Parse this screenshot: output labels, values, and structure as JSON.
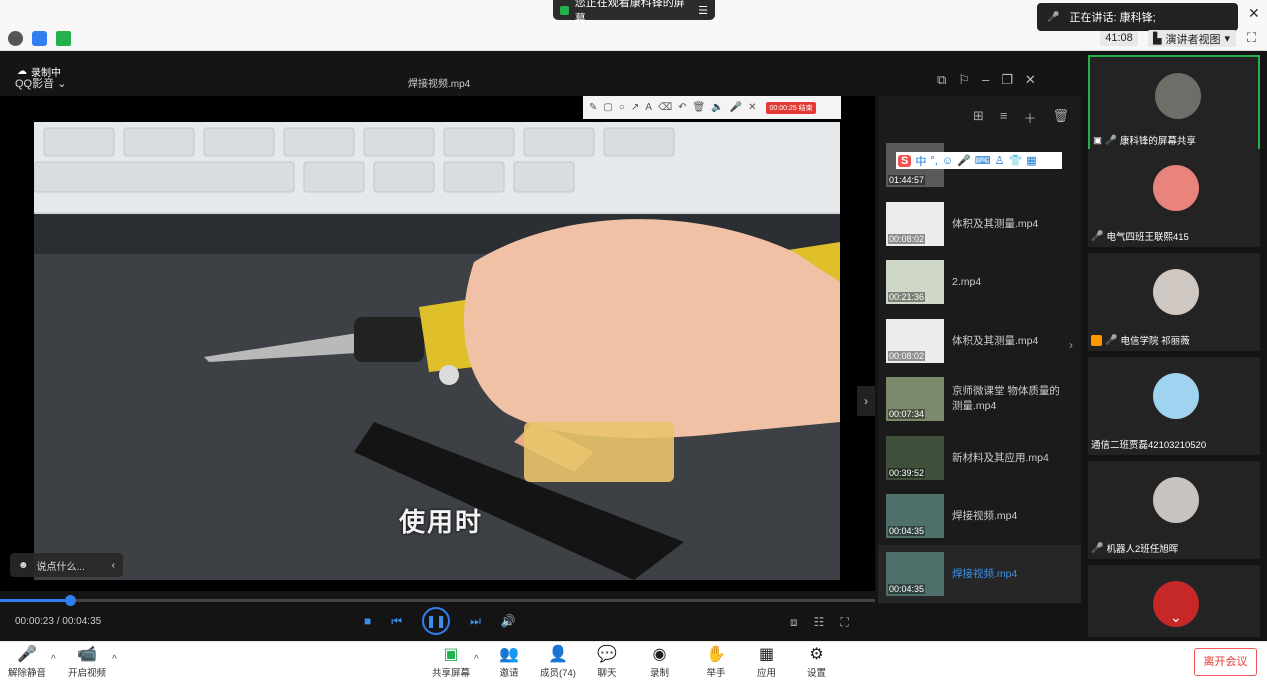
{
  "top": {
    "viewing_banner": "您正在观看康科锋的屏幕",
    "speaking": "正在讲话: 康科锋;",
    "timer": "41:08",
    "presenter_view": "演讲者视图"
  },
  "player": {
    "rec_label": "录制中",
    "app_name": "QQ影音",
    "file_title": "焊接视频.mp4",
    "subtitle": "使用时",
    "chat_placeholder": "说点什么...",
    "rec_chip": "00:00:25 结束",
    "time": "00:00:23 / 00:04:35",
    "progress": 0.08
  },
  "playlist": [
    {
      "name": "",
      "dur": "01:44:57"
    },
    {
      "name": "体积及其测量.mp4",
      "dur": "00:08:02"
    },
    {
      "name": "2.mp4",
      "dur": "00:21:36"
    },
    {
      "name": "体积及其测量.mp4",
      "dur": "00:08:02"
    },
    {
      "name": "京师微课堂 物体质量的测量.mp4",
      "dur": "00:07:34"
    },
    {
      "name": "新材料及其应用.mp4",
      "dur": "00:39:52"
    },
    {
      "name": "焊接视频.mp4",
      "dur": "00:04:35"
    },
    {
      "name": "焊接视频.mp4",
      "dur": "00:04:35",
      "active": true
    }
  ],
  "ime": {
    "logo": "S",
    "mode": "中"
  },
  "participants": [
    {
      "name": "康科锋的屏幕共享",
      "avatar_color": "#6b6f68",
      "active": true
    },
    {
      "name": "电气四班王联熙415",
      "avatar_color": "#e8847c"
    },
    {
      "name": "电信学院 祁丽薇",
      "avatar_color": "#cfc8c2"
    },
    {
      "name": "通信二班贾磊42103210520",
      "avatar_color": "#9fd3f0"
    },
    {
      "name": "机器人2班任旭晖",
      "avatar_color": "#c8c3bf"
    },
    {
      "name": "",
      "avatar_color": "#c62828"
    }
  ],
  "bottom": {
    "unmute": "解除静音",
    "start_video": "开启视频",
    "share": "共享屏幕",
    "invite": "邀请",
    "members": "成员(74)",
    "chat": "聊天",
    "record": "录制",
    "raise_hand": "举手",
    "apps": "应用",
    "settings": "设置",
    "leave": "离开会议"
  }
}
